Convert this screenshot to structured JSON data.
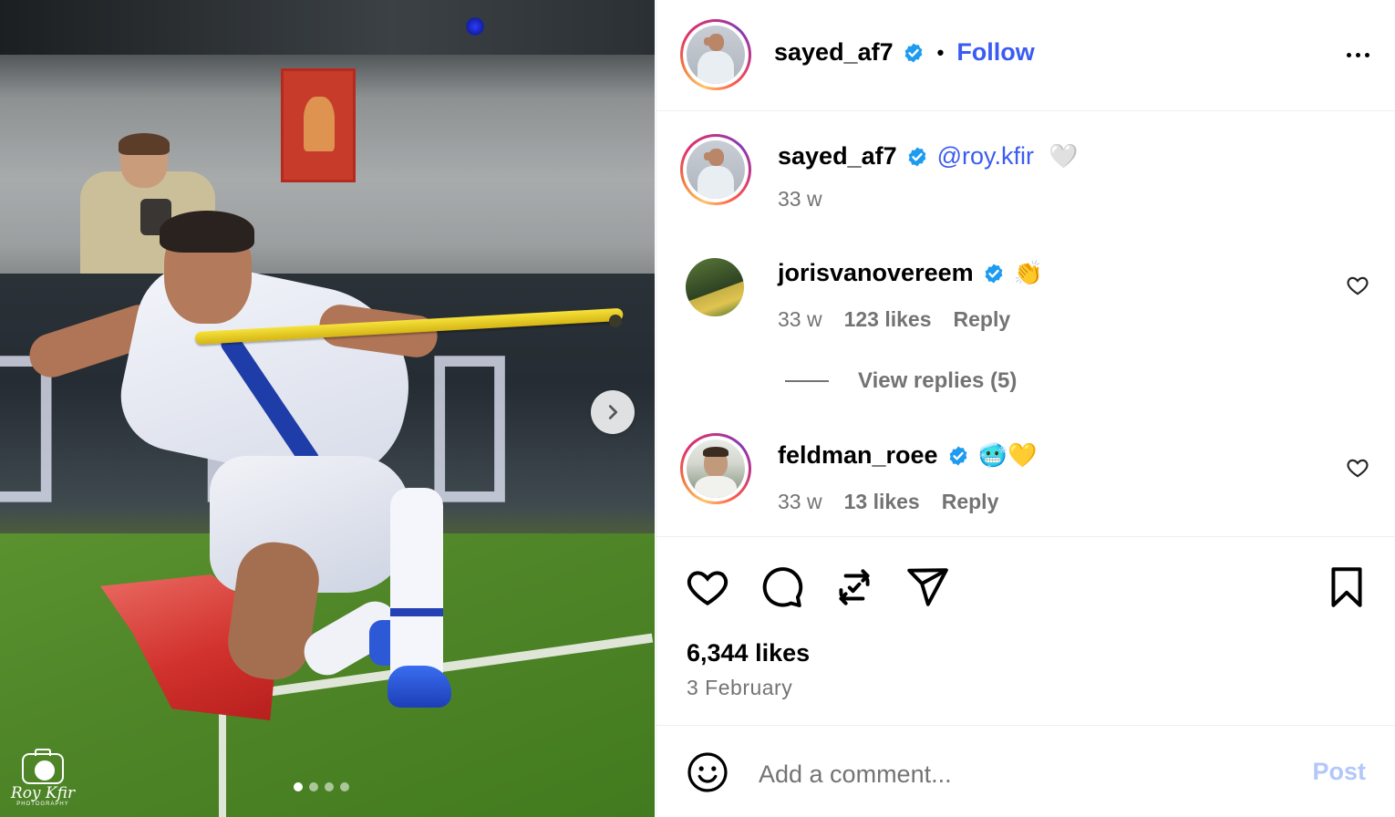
{
  "post": {
    "author": "sayed_af7",
    "follow_label": "Follow",
    "separator": "•",
    "caption": {
      "author": "sayed_af7",
      "mention": "@roy.kfir",
      "emoji": "🤍",
      "time": "33 w"
    },
    "likes": "6,344 likes",
    "date": "3 February"
  },
  "media": {
    "carousel_count": 4,
    "active_index": 0,
    "watermark_name": "Roy Kfir",
    "watermark_sub": "PHOTOGRAPHY"
  },
  "comments": [
    {
      "username": "jorisvanovereem",
      "emoji": "👏",
      "time": "33 w",
      "likes": "123 likes",
      "reply_label": "Reply",
      "view_replies": "View replies (5)"
    },
    {
      "username": "feldman_roee",
      "emoji": "🥶💛",
      "time": "33 w",
      "likes": "13 likes",
      "reply_label": "Reply"
    }
  ],
  "composer": {
    "placeholder": "Add a comment...",
    "post_label": "Post"
  },
  "icons": {
    "verified": "verified-badge-icon",
    "like": "heart-icon",
    "comment": "comment-icon",
    "repost": "repost-icon",
    "share": "share-icon",
    "save": "bookmark-icon",
    "emoji": "smiley-icon",
    "more": "more-options-icon",
    "next": "chevron-right-icon"
  },
  "colors": {
    "accent": "#3b5bf3",
    "muted": "#737373",
    "post_disabled": "#b2c7fa",
    "verified": "#1d9bf0"
  }
}
